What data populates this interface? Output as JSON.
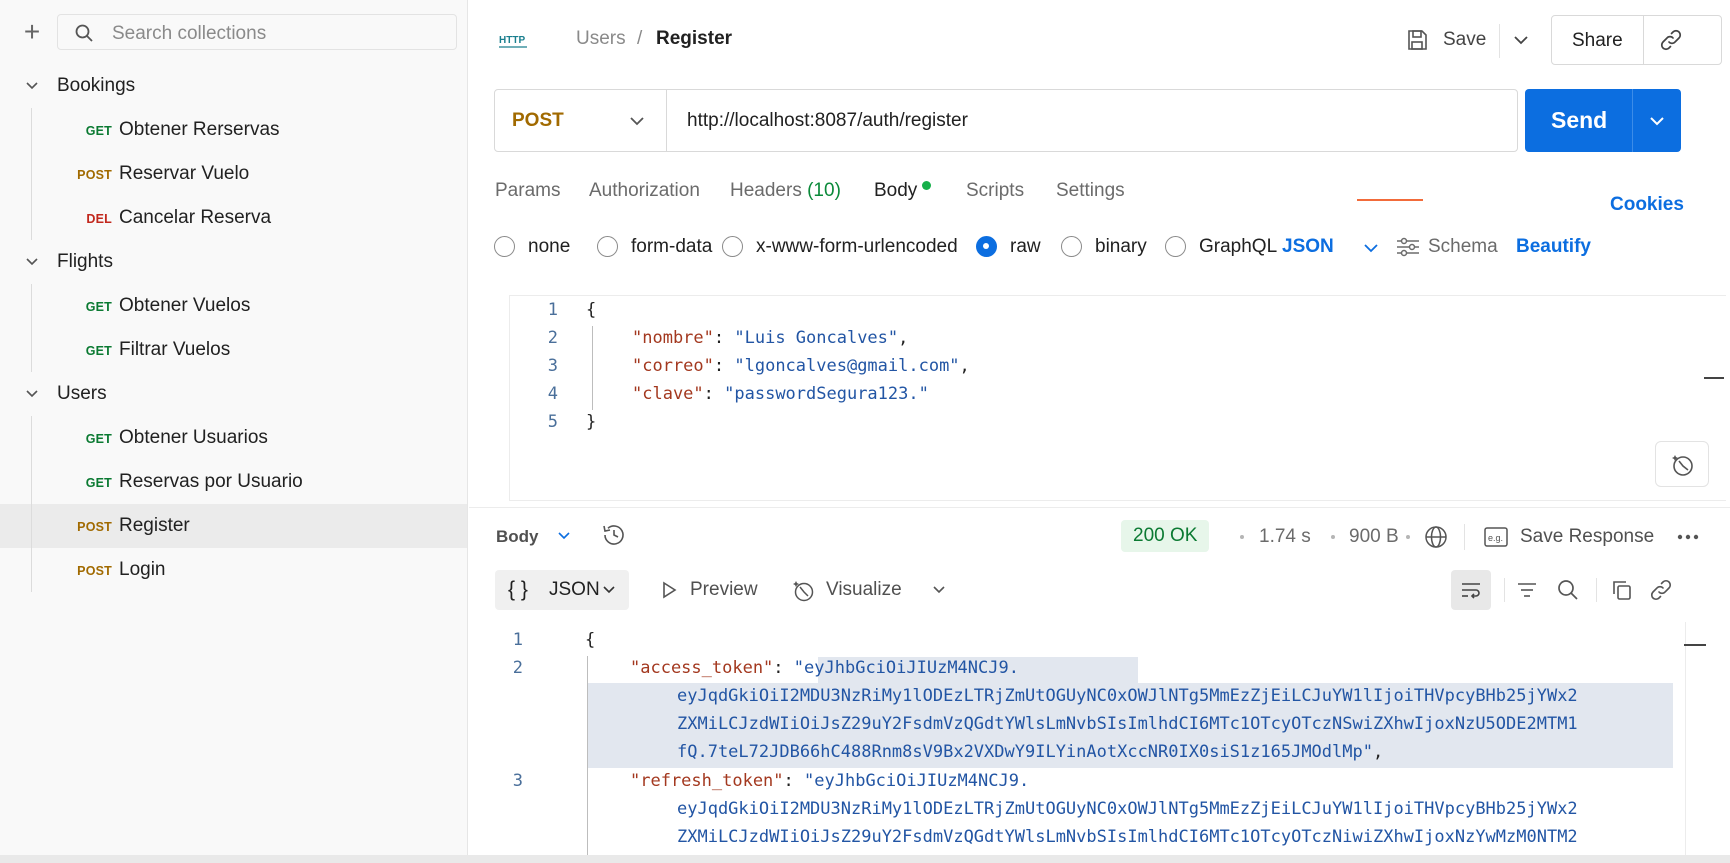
{
  "sidebar": {
    "search_placeholder": "Search collections",
    "folders": [
      {
        "name": "Bookings",
        "requests": [
          {
            "method": "GET",
            "name": "Obtener Rerservas"
          },
          {
            "method": "POST",
            "name": "Reservar Vuelo"
          },
          {
            "method": "DEL",
            "name": "Cancelar Reserva"
          }
        ]
      },
      {
        "name": "Flights",
        "requests": [
          {
            "method": "GET",
            "name": "Obtener Vuelos"
          },
          {
            "method": "GET",
            "name": "Filtrar Vuelos"
          }
        ]
      },
      {
        "name": "Users",
        "requests": [
          {
            "method": "GET",
            "name": "Obtener Usuarios"
          },
          {
            "method": "GET",
            "name": "Reservas por Usuario"
          },
          {
            "method": "POST",
            "name": "Register"
          },
          {
            "method": "POST",
            "name": "Login"
          }
        ]
      }
    ]
  },
  "header": {
    "breadcrumb_parent": "Users",
    "breadcrumb_sep": "/",
    "breadcrumb_current": "Register",
    "save_label": "Save",
    "share_label": "Share"
  },
  "request": {
    "method": "POST",
    "url": "http://localhost:8087/auth/register",
    "send_label": "Send"
  },
  "tabs": {
    "params": "Params",
    "authorization": "Authorization",
    "headers": "Headers",
    "headers_count": "(10)",
    "body": "Body",
    "scripts": "Scripts",
    "settings": "Settings",
    "cookies": "Cookies"
  },
  "body_types": {
    "none": "none",
    "form_data": "form-data",
    "urlencoded": "x-www-form-urlencoded",
    "raw": "raw",
    "binary": "binary",
    "graphql": "GraphQL",
    "language": "JSON",
    "schema": "Schema",
    "beautify": "Beautify"
  },
  "request_body": {
    "line_numbers": [
      "1",
      "2",
      "3",
      "4",
      "5"
    ],
    "open": "{",
    "fields": [
      {
        "key": "\"nombre\"",
        "value": "\"Luis Goncalves\"",
        "trail": ","
      },
      {
        "key": "\"correo\"",
        "value": "\"lgoncalves@gmail.com\"",
        "trail": ","
      },
      {
        "key": "\"clave\"",
        "value": "\"passwordSegura123.\"",
        "trail": ""
      }
    ],
    "close": "}"
  },
  "response": {
    "body_label": "Body",
    "status": "200 OK",
    "time": "1.74 s",
    "size": "900 B",
    "save_response": "Save Response",
    "format": "JSON",
    "preview": "Preview",
    "visualize": "Visualize",
    "line_numbers": [
      "1",
      "2",
      "3"
    ],
    "open": "{",
    "access_key": "\"access_token\"",
    "access_lines": [
      "eyJhbGciOiJIUzM4NCJ9.",
      "eyJqdGkiOiI2MDU3NzRiMy1lODEzLTRjZmUtOGUyNC0xOWJlNTg5MmEzZjEiLCJuYW1lIjoiTHVpcyBHb25jYWx2",
      "ZXMiLCJzdWIiOiJsZ29uY2FsdmVzQGdtYWlsLmNvbSIsImlhdCI6MTc1OTcyOTczNSwiZXhwIjoxNzU5ODE2MTM1",
      "fQ.7teL72JDB66hC488Rnm8sV9Bx2VXDwY9ILYinAotXccNR0IX0siS1z165JMOdlMp"
    ],
    "refresh_key": "\"refresh_token\"",
    "refresh_lines": [
      "eyJhbGciOiJIUzM4NCJ9.",
      "eyJqdGkiOiI2MDU3NzRiMy1lODEzLTRjZmUtOGUyNC0xOWJlNTg5MmEzZjEiLCJuYW1lIjoiTHVpcyBHb25jYWx2",
      "ZXMiLCJzdWIiOiJsZ29uY2FsdmVzQGdtYWlsLmNvbSIsImlhdCI6MTc1OTcyOTczNiwiZXhwIjoxNzYwMzM0NTM2"
    ]
  },
  "colors": {
    "accent": "#0c6ee0",
    "get": "#0b7a32",
    "post": "#a16a00",
    "del": "#c2281d",
    "json_key": "#a3381f",
    "json_string": "#2255a4"
  }
}
